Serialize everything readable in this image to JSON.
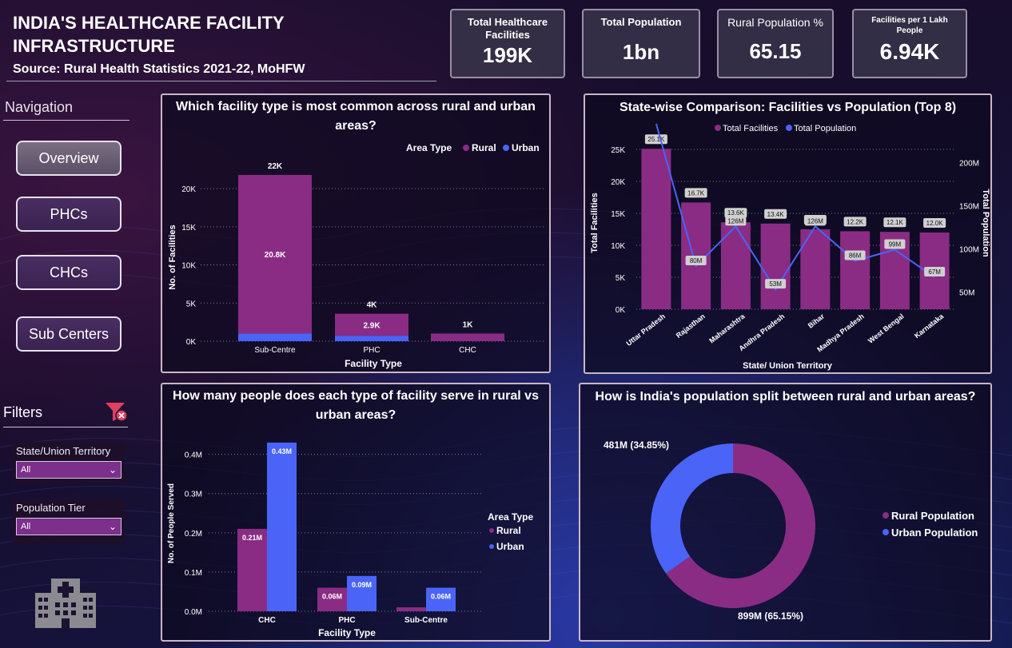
{
  "header": {
    "title": "INDIA'S HEALTHCARE FACILITY INFRASTRUCTURE",
    "source": "Source: Rural Health Statistics 2021-22, MoHFW"
  },
  "kpis": [
    {
      "label": "Total Healthcare Facilities",
      "value": "199K"
    },
    {
      "label": "Total Population",
      "value": "1bn"
    },
    {
      "label": "Rural Population %",
      "value": "65.15"
    },
    {
      "label": "Facilities per 1 Lakh People",
      "value": "6.94K"
    }
  ],
  "nav": {
    "heading": "Navigation",
    "buttons": [
      "Overview",
      "PHCs",
      "CHCs",
      "Sub Centers"
    ]
  },
  "filters": {
    "heading": "Filters",
    "slicers": [
      {
        "label": "State/Union Territory",
        "value": "All"
      },
      {
        "label": "Population Tier",
        "value": "All"
      }
    ]
  },
  "colors": {
    "rural": "#8a2c84",
    "urban": "#4a64f8",
    "label_box": "#d0d0d0"
  },
  "icons": {
    "clear_filter": "funnel-clear-icon",
    "logo": "hospital-building-icon"
  },
  "chart_data": [
    {
      "id": "facility_type",
      "type": "bar",
      "stacked": true,
      "title": "Which facility type is most common across rural and urban areas?",
      "legend_title": "Area Type",
      "xlabel": "Facility Type",
      "ylabel": "No. of Facilities",
      "categories": [
        "Sub-Centre",
        "PHC",
        "CHC"
      ],
      "series": [
        {
          "name": "Rural",
          "values": [
            20800,
            2900,
            1000
          ],
          "labels": [
            "20.8K",
            "2.9K",
            ""
          ]
        },
        {
          "name": "Urban",
          "values": [
            1000,
            700,
            0
          ]
        }
      ],
      "totals": [
        "22K",
        "4K",
        "1K"
      ],
      "ylim": [
        0,
        22000
      ],
      "yticks": [
        0,
        5000,
        10000,
        15000,
        20000
      ],
      "ytick_labels": [
        "0K",
        "5K",
        "10K",
        "15K",
        "20K"
      ],
      "grid": true,
      "legend_position": "top-right"
    },
    {
      "id": "state_comparison",
      "type": "bar",
      "title": "State-wise Comparison: Facilities vs Population (Top 8)",
      "xlabel": "State/ Union Territory",
      "ylabel": "Total Facilities",
      "y2label": "Total Population",
      "categories": [
        "Uttar Pradesh",
        "Rajasthan",
        "Maharashtra",
        "Andhra Pradesh",
        "Bihar",
        "Madhya Pradesh",
        "West Bengal",
        "Karnataka"
      ],
      "series": [
        {
          "name": "Total Facilities",
          "chart": "bar",
          "values": [
            25100,
            16700,
            13600,
            13400,
            12500,
            12200,
            12100,
            12000
          ],
          "labels": [
            "25.1K",
            "16.7K",
            "13.6K",
            "13.4K",
            "12.5K",
            "12.2K",
            "12.1K",
            "12.0K"
          ]
        },
        {
          "name": "Total Population",
          "chart": "line",
          "axis": "secondary",
          "values": [
            245,
            80,
            126,
            53,
            126,
            86,
            99,
            67
          ],
          "labels": [
            "",
            "80M",
            "126M",
            "53M",
            "126M",
            "86M",
            "99M",
            "67M"
          ]
        }
      ],
      "ylim": [
        0,
        27000
      ],
      "yticks": [
        0,
        5000,
        10000,
        15000,
        20000,
        25000
      ],
      "ytick_labels": [
        "0K",
        "5K",
        "10K",
        "15K",
        "20K",
        "25K"
      ],
      "y2lim": [
        30,
        230
      ],
      "y2ticks": [
        50,
        100,
        150,
        200
      ],
      "y2tick_labels": [
        "50M",
        "100M",
        "150M",
        "200M"
      ],
      "grid": true,
      "legend_position": "top"
    },
    {
      "id": "people_served",
      "type": "bar",
      "title": "How many people does each type of facility serve in rural vs urban areas?",
      "legend_title": "Area Type",
      "xlabel": "Facility Type",
      "ylabel": "No. of People Served",
      "categories": [
        "CHC",
        "PHC",
        "Sub-Centre"
      ],
      "series": [
        {
          "name": "Rural",
          "values": [
            0.21,
            0.06,
            0.01
          ],
          "labels": [
            "0.21M",
            "0.06M",
            ""
          ]
        },
        {
          "name": "Urban",
          "values": [
            0.43,
            0.09,
            0.06
          ],
          "labels": [
            "0.43M",
            "0.09M",
            "0.06M"
          ]
        }
      ],
      "ylim": [
        0,
        0.44
      ],
      "yticks": [
        0,
        0.1,
        0.2,
        0.3,
        0.4
      ],
      "ytick_labels": [
        "0.0M",
        "0.1M",
        "0.2M",
        "0.3M",
        "0.4M"
      ],
      "grid": true,
      "legend_position": "right"
    },
    {
      "id": "population_split",
      "type": "pie",
      "donut": true,
      "title": "How is India's population split between rural and urban areas?",
      "slices": [
        {
          "name": "Rural Population",
          "value": 65.15,
          "label": "899M (65.15%)"
        },
        {
          "name": "Urban Population",
          "value": 34.85,
          "label": "481M (34.85%)"
        }
      ],
      "legend_position": "right"
    }
  ]
}
